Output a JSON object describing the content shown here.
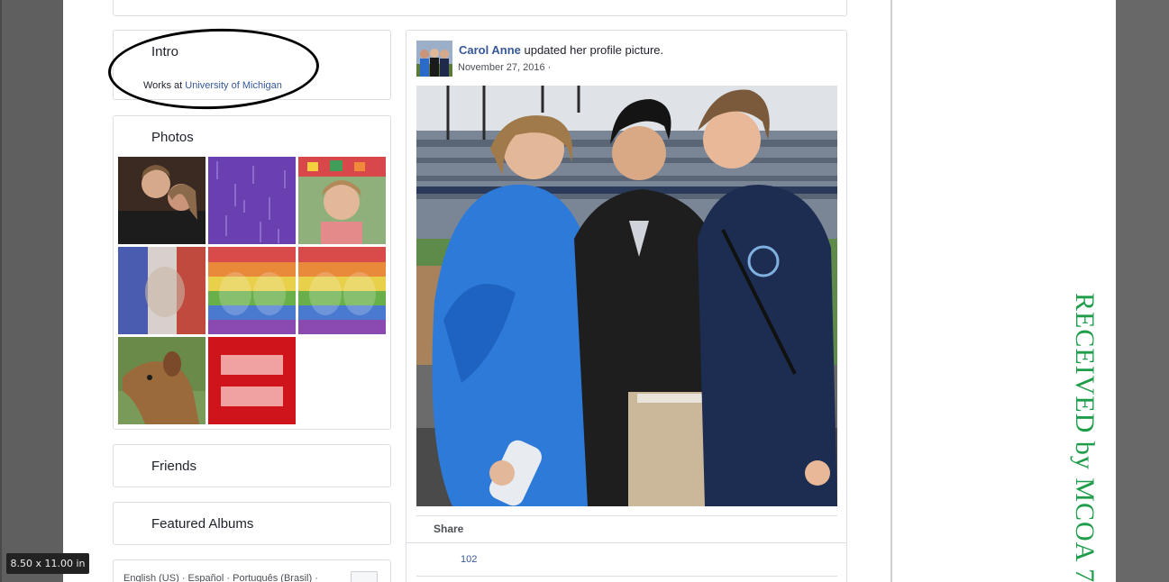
{
  "intro": {
    "title": "Intro",
    "works_prefix": "Works at",
    "works_link": "University of Michigan"
  },
  "photos": {
    "title": "Photos",
    "items": [
      {
        "name": "photo-two-women"
      },
      {
        "name": "photo-purple-rain"
      },
      {
        "name": "photo-woman-festival"
      },
      {
        "name": "photo-french-flag-filter"
      },
      {
        "name": "photo-rainbow-filter-1"
      },
      {
        "name": "photo-rainbow-filter-2"
      },
      {
        "name": "photo-dog"
      },
      {
        "name": "photo-equality-logo"
      }
    ]
  },
  "friends": {
    "title": "Friends"
  },
  "albums": {
    "title": "Featured Albums"
  },
  "footer": {
    "lang_en": "English (US)",
    "sep": "·",
    "lang_es": "Español",
    "lang_pt": "Português (Brasil)"
  },
  "post": {
    "author": "Carol Anne",
    "action": "updated her profile picture.",
    "date": "November 27, 2016 ·",
    "share": "Share",
    "likes": "102"
  },
  "stamp": {
    "text": "RECEIVED by MCOA 7/"
  },
  "viewer": {
    "page_size": "8.50 x 11.00 in"
  },
  "colors": {
    "link": "#365899",
    "stamp_green": "#1f9d4b",
    "card_border": "#dcdee3"
  }
}
